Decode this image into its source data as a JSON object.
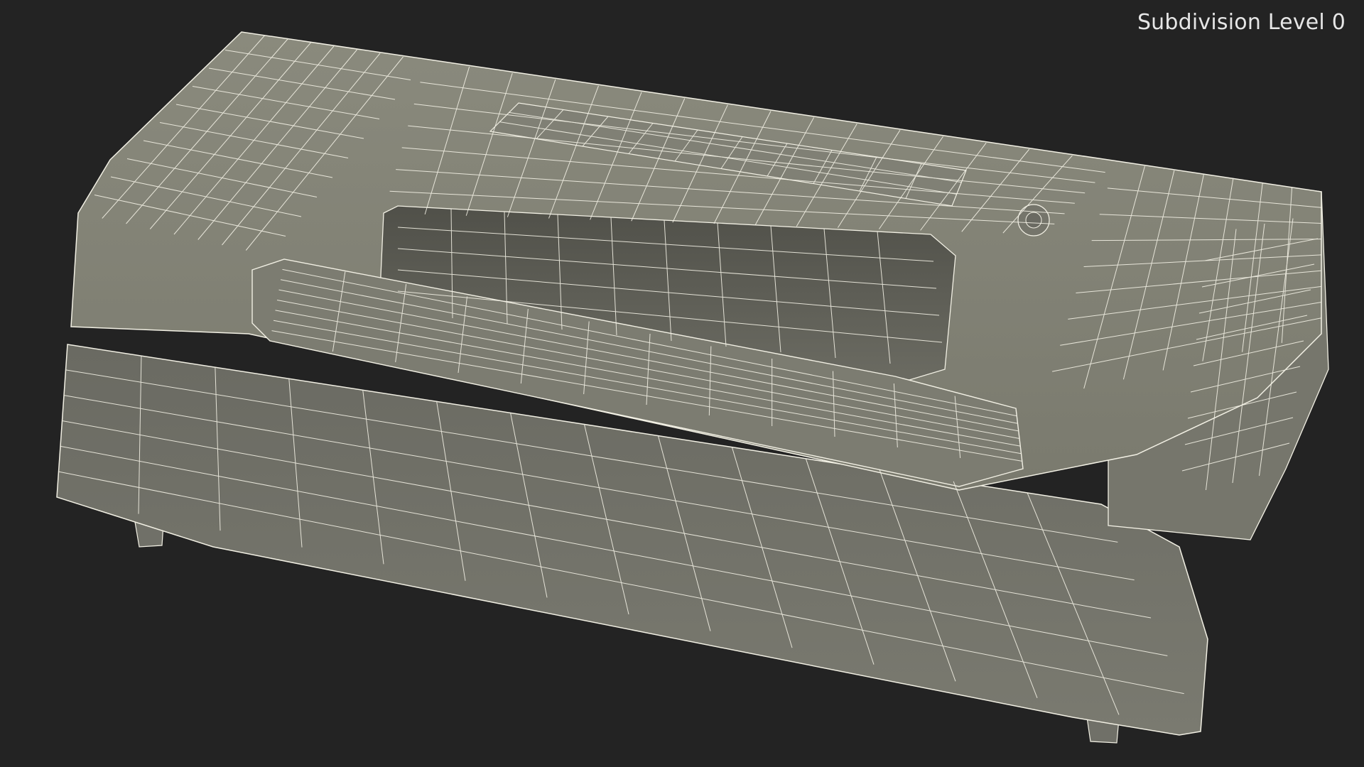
{
  "viewport": {
    "subdivision_label": "Subdivision Level 0"
  },
  "colors": {
    "background": "#232323",
    "wire": "#f2f0e4",
    "surface_top": "#858578",
    "surface_front": "#707068",
    "surface_dark": "#55554f",
    "label_text": "#e6e6e6"
  }
}
